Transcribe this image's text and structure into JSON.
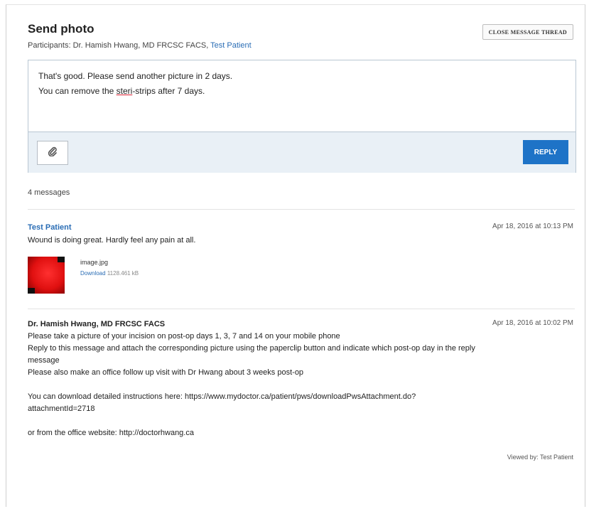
{
  "thread": {
    "title": "Send photo",
    "participants_label": "Participants:",
    "participant_doctor": "Dr. Hamish Hwang, MD FRCSC FACS,",
    "participant_patient": "Test Patient",
    "close_label": "CLOSE MESSAGE THREAD"
  },
  "composer": {
    "line1": "That's good. Please send another picture in 2 days.",
    "line2_pre": "You can remove the ",
    "line2_word": "steri",
    "line2_post": "-strips after 7 days.",
    "attach_icon": "paperclip-icon",
    "reply_label": "REPLY"
  },
  "messages_count": "4 messages",
  "messages": [
    {
      "author": "Test Patient",
      "time": "Apr 18, 2016 at 10:13 PM",
      "body": "Wound is doing great. Hardly feel any pain at all.",
      "attachment": {
        "name": "image.jpg",
        "download_label": "Download",
        "size": "1128.461 kB"
      }
    },
    {
      "author": "Dr. Hamish Hwang, MD FRCSC FACS",
      "time": "Apr 18, 2016 at 10:02 PM",
      "lines": [
        "Please take a picture of your incision on post-op days 1, 3, 7 and 14 on your mobile phone",
        "Reply to this message and attach the corresponding picture using the paperclip button and indicate which post-op day in the reply",
        "message",
        "Please also make an office follow up visit with Dr Hwang about 3 weeks post-op",
        "",
        "You can download detailed instructions here: https://www.mydoctor.ca/patient/pws/downloadPwsAttachment.do?",
        "attachmentId=2718",
        "",
        "or from the office website: http://doctorhwang.ca"
      ],
      "viewed_by": "Viewed by: Test Patient"
    }
  ]
}
